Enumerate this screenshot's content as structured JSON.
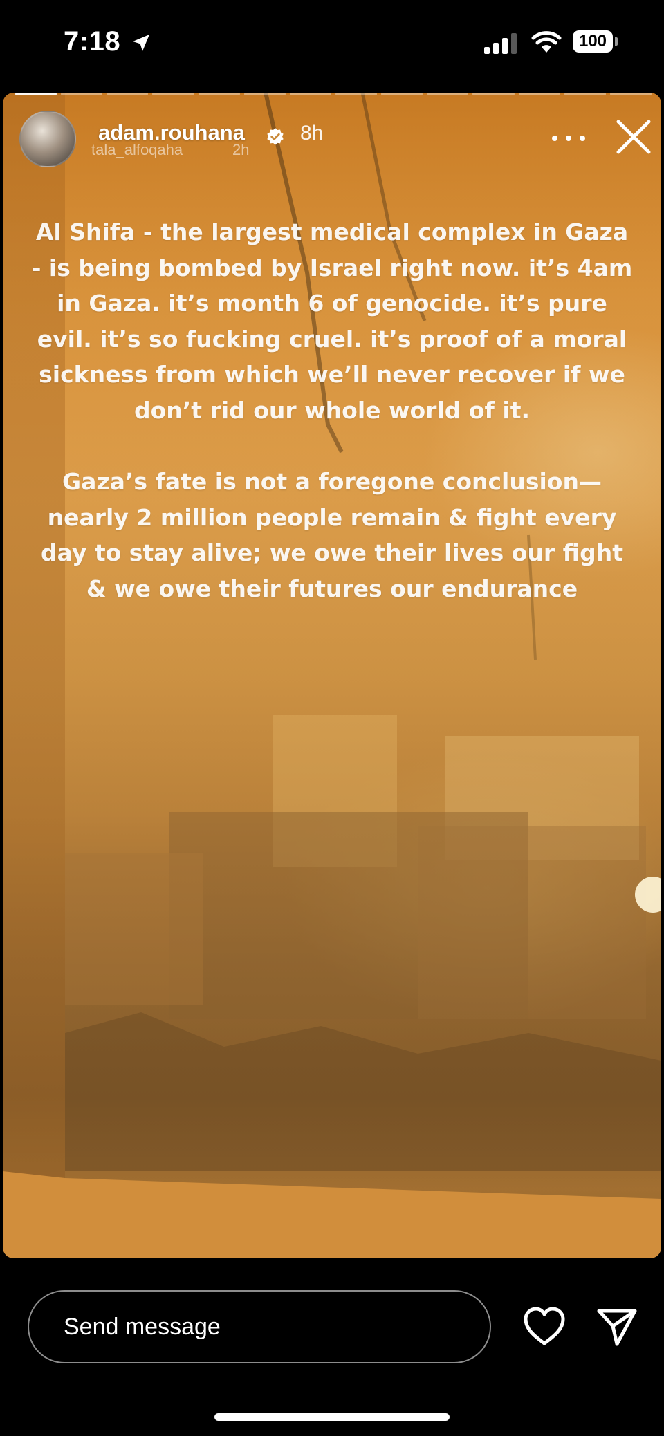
{
  "status_bar": {
    "time": "7:18",
    "battery": "100",
    "icons": [
      "location-arrow-icon",
      "signal-icon",
      "wifi-icon",
      "battery-icon"
    ]
  },
  "story": {
    "progress_segments": 14,
    "progress_done": 1,
    "user": {
      "username": "adam.rouhana",
      "verified": true,
      "time_ago": "8h",
      "shared_from_username": "tala_alfoqaha",
      "shared_from_time": "2h"
    },
    "caption": {
      "paragraph_1": "Al Shifa - the largest medical complex in Gaza - is being bombed by Israel right now. it’s 4am in Gaza. it’s month 6 of genocide. it’s pure evil. it’s so fucking cruel. it’s proof of a moral sickness from which we’ll never recover if we don’t rid our whole world of it.",
      "paragraph_2": "Gaza’s fate is not a foregone conclusion—nearly 2 million people remain & fight every day to stay alive; we owe their lives our fight & we owe their futures our endurance"
    },
    "icons": [
      "verified-badge-icon",
      "more-options-icon",
      "close-icon"
    ]
  },
  "bottom_bar": {
    "message_placeholder": "Send message",
    "icons": [
      "heart-icon",
      "send-icon"
    ]
  },
  "colors": {
    "story_tint": "#d9923a",
    "background": "#000000",
    "verified_badge": "#ffffff"
  }
}
